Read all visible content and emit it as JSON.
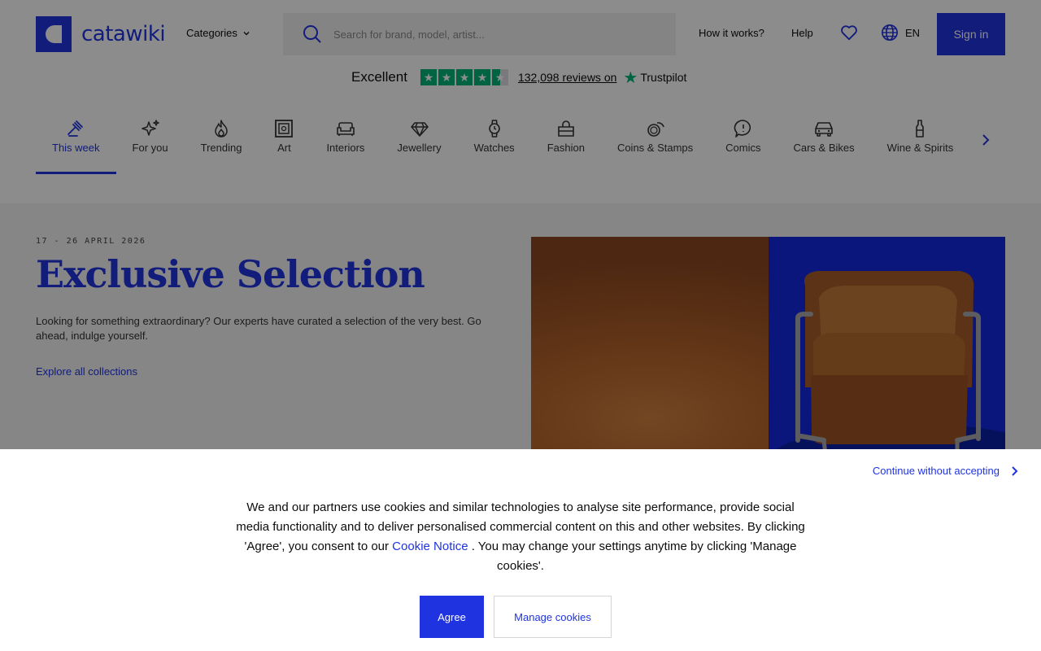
{
  "header": {
    "logo_text": "catawiki",
    "categories_label": "Categories",
    "search_placeholder": "Search for brand, model, artist...",
    "how_it_works": "How it works?",
    "help": "Help",
    "language": "EN",
    "sign_in": "Sign in"
  },
  "trustpilot": {
    "rating_label": "Excellent",
    "reviews": "132,098 reviews on",
    "brand": "Trustpilot",
    "stars": 4.5
  },
  "categories": [
    {
      "label": "This week",
      "icon": "gavel-icon",
      "active": true
    },
    {
      "label": "For you",
      "icon": "sparkle-icon"
    },
    {
      "label": "Trending",
      "icon": "flame-icon"
    },
    {
      "label": "Art",
      "icon": "frame-icon"
    },
    {
      "label": "Interiors",
      "icon": "sofa-icon"
    },
    {
      "label": "Jewellery",
      "icon": "diamond-icon"
    },
    {
      "label": "Watches",
      "icon": "watch-icon"
    },
    {
      "label": "Fashion",
      "icon": "bag-icon"
    },
    {
      "label": "Coins & Stamps",
      "icon": "coins-icon"
    },
    {
      "label": "Comics",
      "icon": "speech-bubble-icon"
    },
    {
      "label": "Cars & Bikes",
      "icon": "car-icon"
    },
    {
      "label": "Wine & Spirits",
      "icon": "bottle-icon"
    }
  ],
  "hero": {
    "date": "17 - 26 APRIL 2026",
    "title": "Exclusive Selection",
    "description": "Looking for something extraordinary? Our experts have curated a selection of the very best. Go ahead, indulge yourself.",
    "link": "Explore all collections"
  },
  "cookie": {
    "continue": "Continue without accepting",
    "text_before": "We and our partners use cookies and similar technologies to analyse site performance, provide social media functionality and to deliver personalised commercial content on this and other websites. By clicking 'Agree', you consent to our ",
    "notice_link": "Cookie Notice",
    "text_after": " . You may change your settings anytime by clicking 'Manage cookies'.",
    "agree": "Agree",
    "manage": "Manage cookies"
  },
  "colors": {
    "brand_blue": "#1f33e0",
    "trustpilot_green": "#00b67a"
  }
}
